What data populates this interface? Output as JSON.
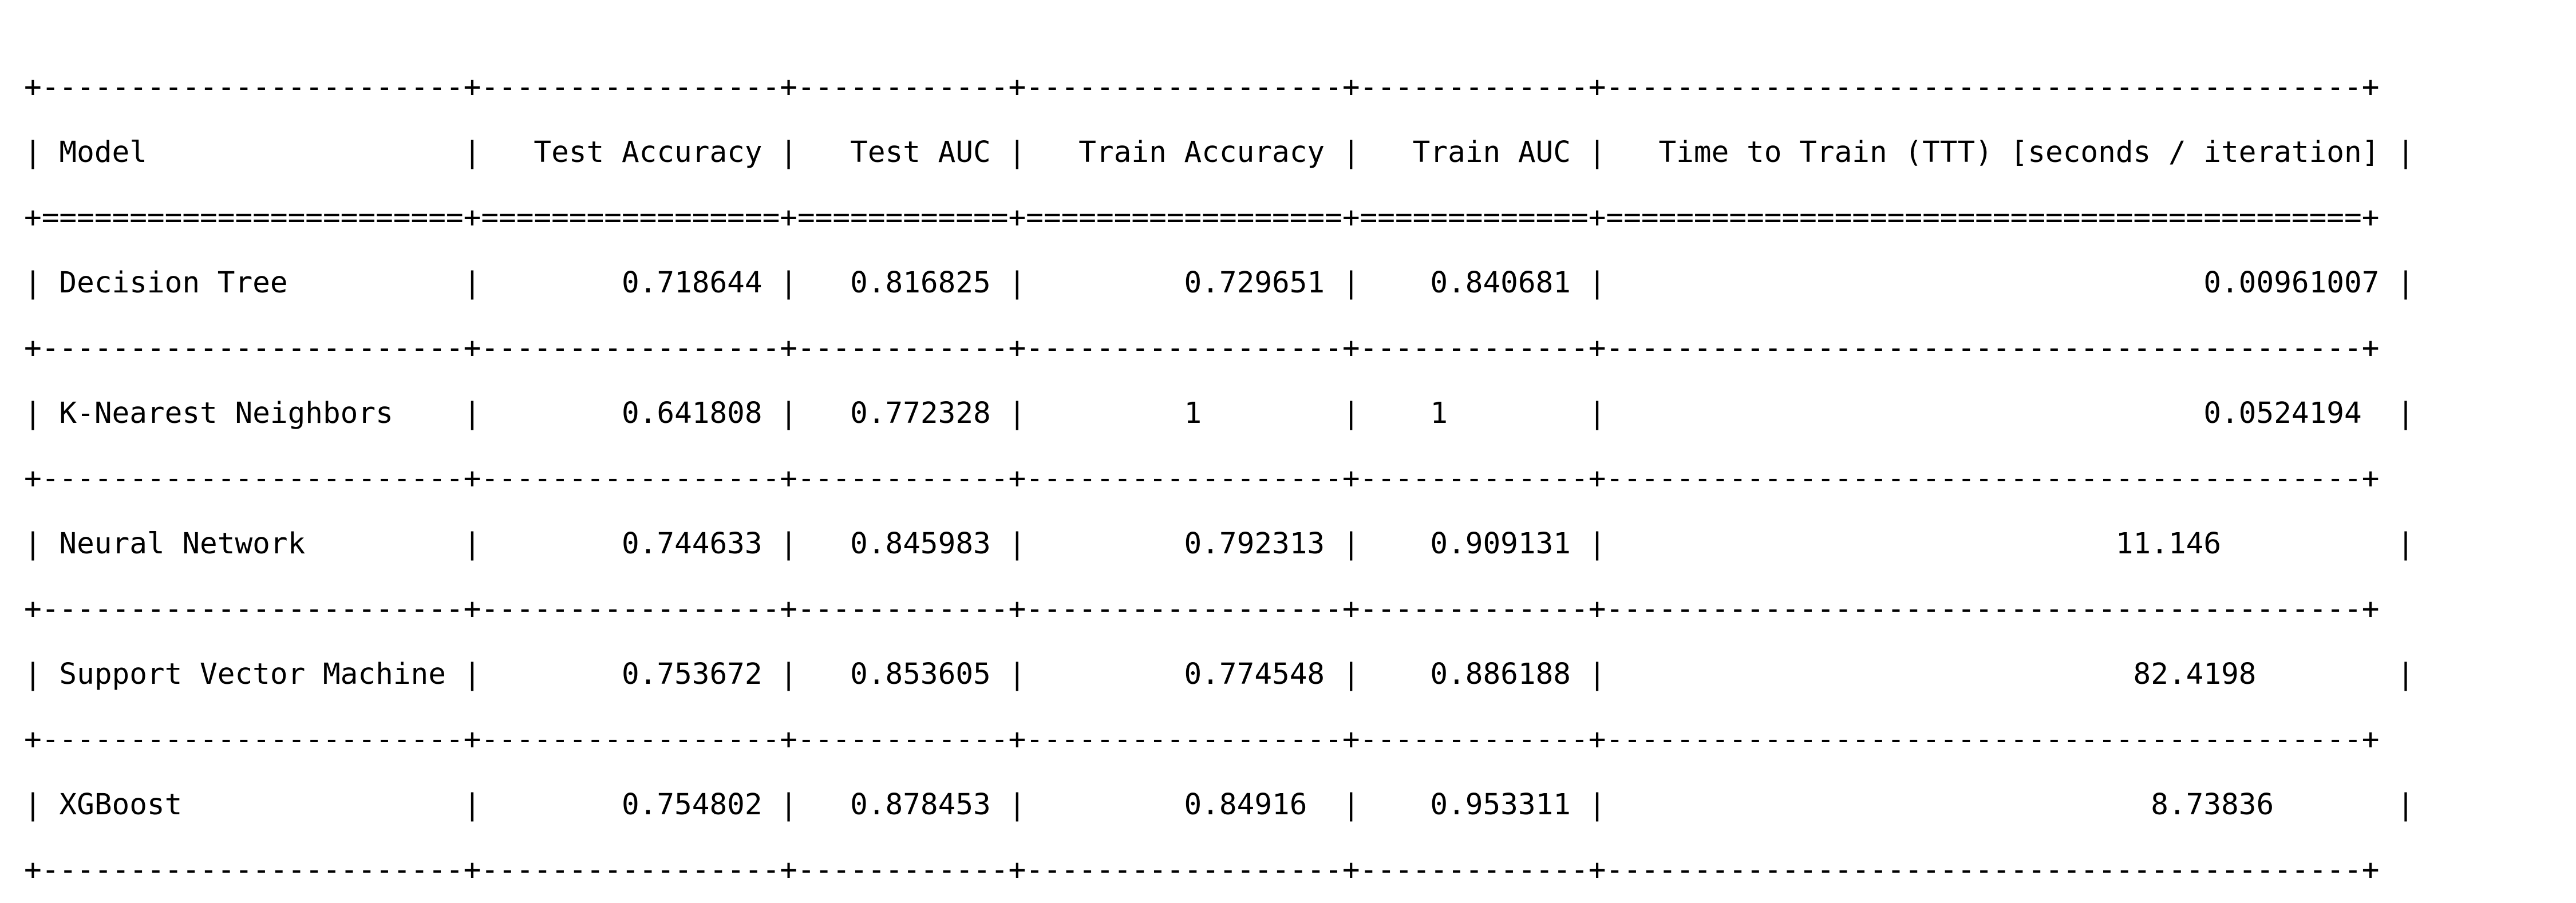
{
  "table": {
    "lines": [
      "+------------------------+-----------------+------------+------------------+-------------+-------------------------------------------+",
      "| Model                  |   Test Accuracy |   Test AUC |   Train Accuracy |   Train AUC |   Time to Train (TTT) [seconds / iteration] |",
      "+========================+=================+============+==================+=============+===========================================+",
      "| Decision Tree          |        0.718644 |   0.816825 |         0.729651 |    0.840681 |                                  0.00961007 |",
      "+------------------------+-----------------+------------+------------------+-------------+-------------------------------------------+",
      "| K-Nearest Neighbors    |        0.641808 |   0.772328 |         1        |    1        |                                  0.0524194  |",
      "+------------------------+-----------------+------------+------------------+-------------+-------------------------------------------+",
      "| Neural Network         |        0.744633 |   0.845983 |         0.792313 |    0.909131 |                             11.146          |",
      "+------------------------+-----------------+------------+------------------+-------------+-------------------------------------------+",
      "| Support Vector Machine |        0.753672 |   0.853605 |         0.774548 |    0.886188 |                              82.4198        |",
      "+------------------------+-----------------+------------+------------------+-------------+-------------------------------------------+",
      "| XGBoost                |        0.754802 |   0.878453 |         0.84916  |    0.953311 |                               8.73836       |",
      "+------------------------+-----------------+------------+------------------+-------------+-------------------------------------------+"
    ]
  }
}
